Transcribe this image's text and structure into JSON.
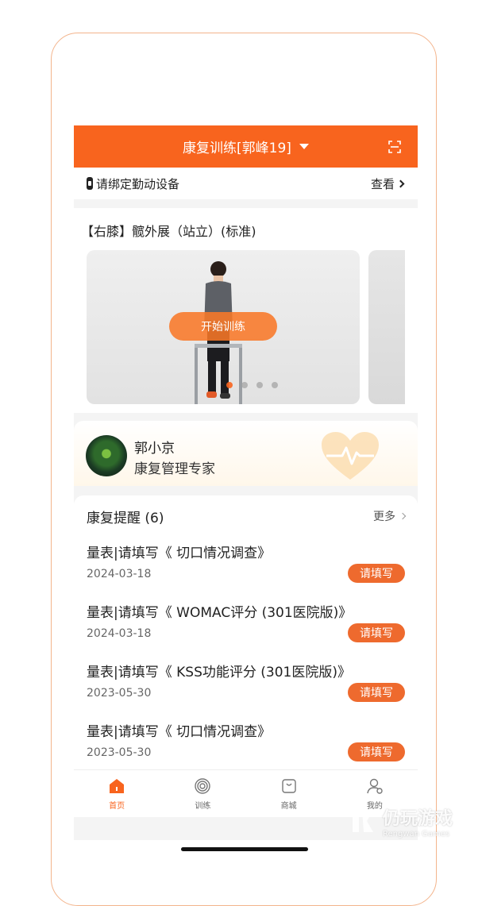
{
  "header": {
    "title": "康复训练[郭峰19]"
  },
  "device_bar": {
    "label": "请绑定勤动设备",
    "view_label": "查看"
  },
  "training": {
    "exercise_title": "【右膝】髋外展（站立）(标准)",
    "start_button": "开始训练",
    "carousel_active_index": 0,
    "carousel_count": 4
  },
  "expert": {
    "name": "郭小京",
    "role": "康复管理专家"
  },
  "reminders": {
    "heading": "康复提醒 (6)",
    "more": "更多",
    "items": [
      {
        "title": "量表|请填写《 切口情况调查》",
        "date": "2024-03-18",
        "action": "请填写"
      },
      {
        "title": "量表|请填写《 WOMAC评分 (301医院版)》",
        "date": "2024-03-18",
        "action": "请填写"
      },
      {
        "title": "量表|请填写《 KSS功能评分 (301医院版)》",
        "date": "2023-05-30",
        "action": "请填写"
      },
      {
        "title": "量表|请填写《 切口情况调查》",
        "date": "2023-05-30",
        "action": "请填写"
      }
    ]
  },
  "tabbar": {
    "tabs": [
      {
        "label": "首页",
        "icon": "home-icon",
        "active": true
      },
      {
        "label": "训练",
        "icon": "target-icon",
        "active": false
      },
      {
        "label": "商城",
        "icon": "shopping-bag-icon",
        "active": false
      },
      {
        "label": "我的",
        "icon": "profile-icon",
        "active": false
      }
    ]
  },
  "watermark": {
    "name_cn": "仍玩游戏",
    "name_en": "Rengwan Games"
  },
  "colors": {
    "accent": "#f8641e",
    "badge": "#ee6a2e",
    "frame_border": "#f3b48c"
  }
}
